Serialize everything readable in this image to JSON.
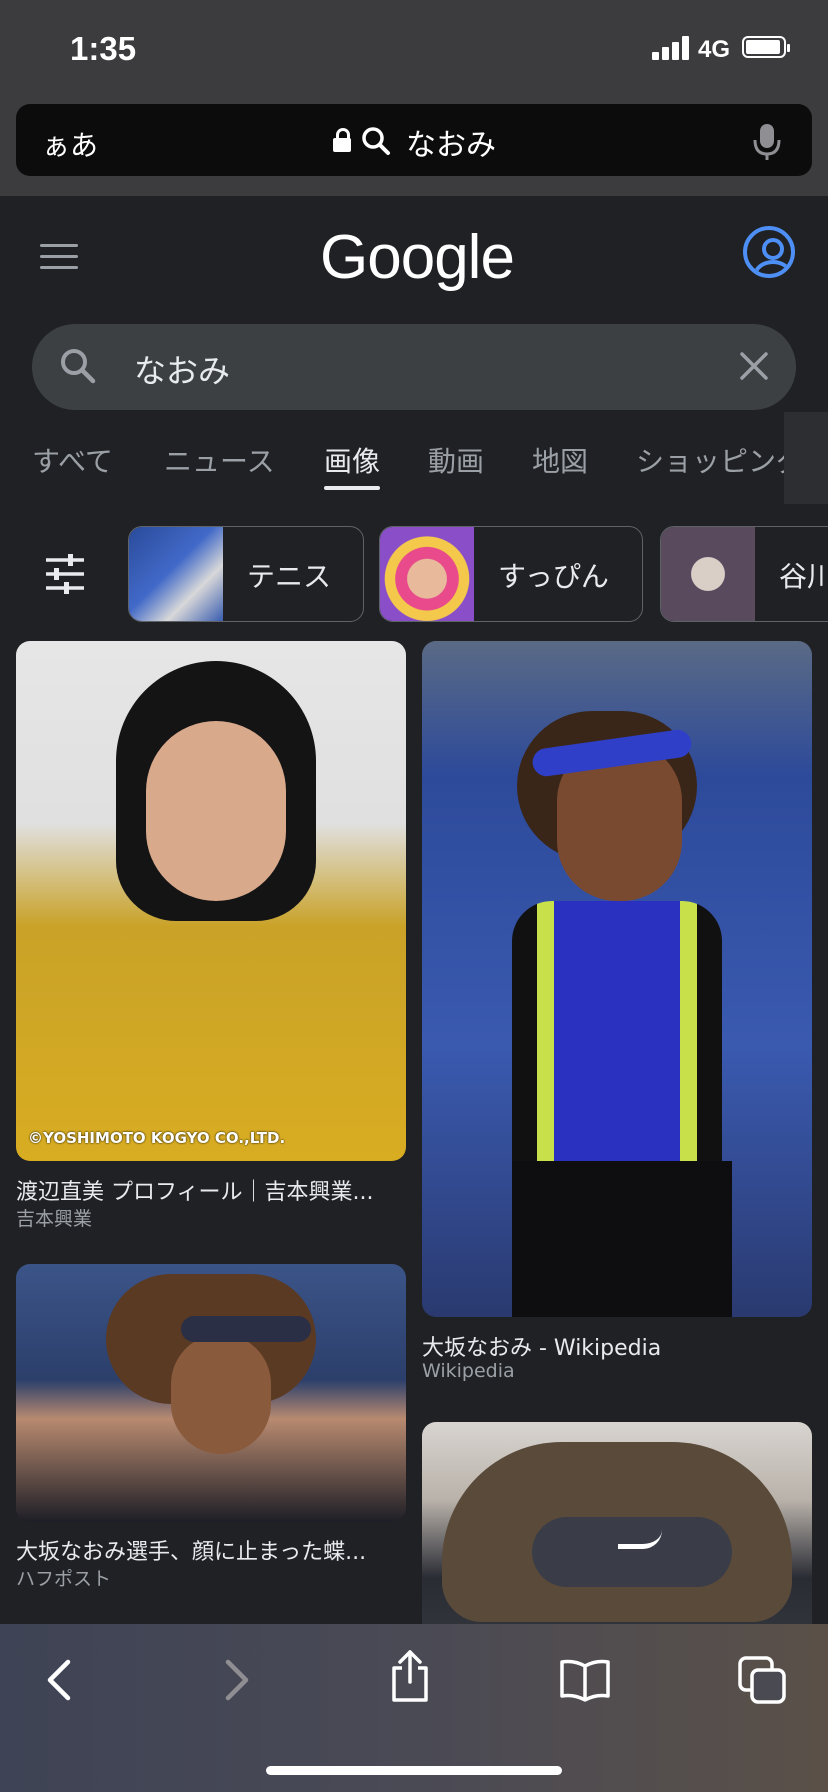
{
  "status": {
    "time": "1:35",
    "network": "4G"
  },
  "address_bar": {
    "aa_label": "ぁあ",
    "query": "なおみ"
  },
  "google": {
    "logo": "Google"
  },
  "search": {
    "query": "なおみ"
  },
  "tabs": [
    {
      "label": "すべて"
    },
    {
      "label": "ニュース"
    },
    {
      "label": "画像",
      "active": true
    },
    {
      "label": "動画"
    },
    {
      "label": "地図"
    },
    {
      "label": "ショッピング"
    }
  ],
  "chips": [
    {
      "label": "テニス"
    },
    {
      "label": "すっぴん"
    },
    {
      "label": "谷川"
    }
  ],
  "results": [
    {
      "watermark": "©YOSHIMOTO KOGYO CO.,LTD.",
      "title": "渡辺直美 プロフィール｜吉本興業...",
      "source": "吉本興業"
    },
    {
      "title": "大坂なおみ - Wikipedia",
      "source": "Wikipedia"
    },
    {
      "title": "大坂なおみ選手、顔に止まった蝶...",
      "source": "ハフポスト"
    },
    {
      "title": "",
      "source": ""
    }
  ],
  "colors": {
    "background": "#202124",
    "accent": "#4d8ff5",
    "chrome": "#3c3c3e"
  }
}
